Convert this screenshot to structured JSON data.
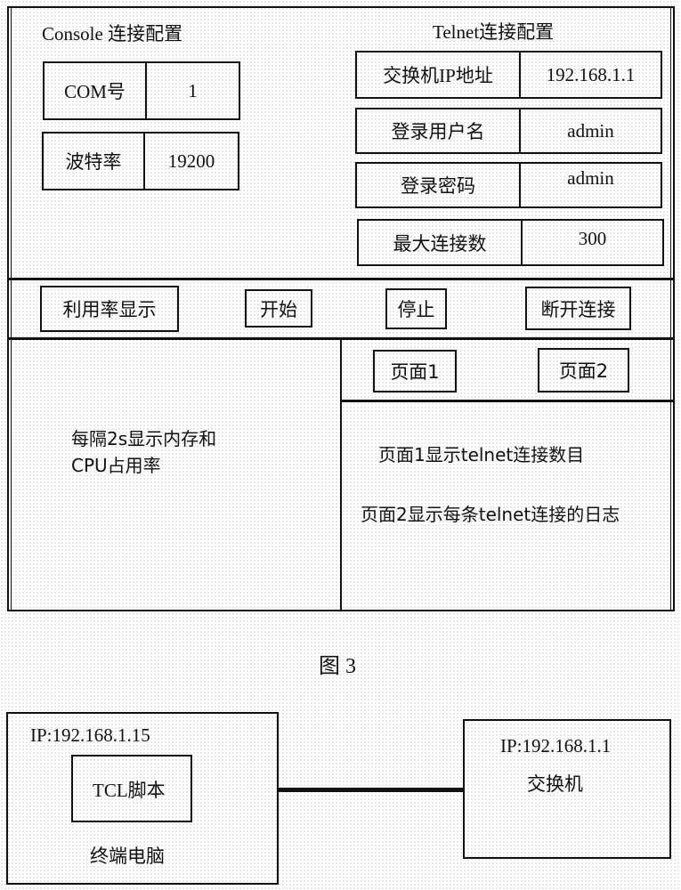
{
  "console_config": {
    "title": "Console 连接配置",
    "fields": [
      {
        "label": "COM号",
        "value": "1"
      },
      {
        "label": "波特率",
        "value": "19200"
      }
    ]
  },
  "telnet_config": {
    "title": "Telnet连接配置",
    "fields": [
      {
        "label": "交换机IP地址",
        "value": "192.168.1.1"
      },
      {
        "label": "登录用户名",
        "value": "admin"
      },
      {
        "label": "登录密码",
        "value": "admin"
      },
      {
        "label": "最大连接数",
        "value": "300"
      }
    ]
  },
  "toolbar": {
    "utilization_label": "利用率显示",
    "start_label": "开始",
    "stop_label": "停止",
    "disconnect_label": "断开连接"
  },
  "utilization_panel": {
    "line1": "每隔2s显示内存和",
    "line2": "CPU占用率"
  },
  "pages_panel": {
    "page1_label": "页面1",
    "page2_label": "页面2",
    "page1_desc": "页面1显示telnet连接数目",
    "page2_desc": "页面2显示每条telnet连接的日志"
  },
  "figure_caption": "图 3",
  "network_diagram": {
    "terminal": {
      "ip": "IP:192.168.1.15",
      "script_label": "TCL脚本",
      "name": "终端电脑"
    },
    "switch": {
      "ip": "IP:192.168.1.1",
      "name": "交换机"
    }
  }
}
